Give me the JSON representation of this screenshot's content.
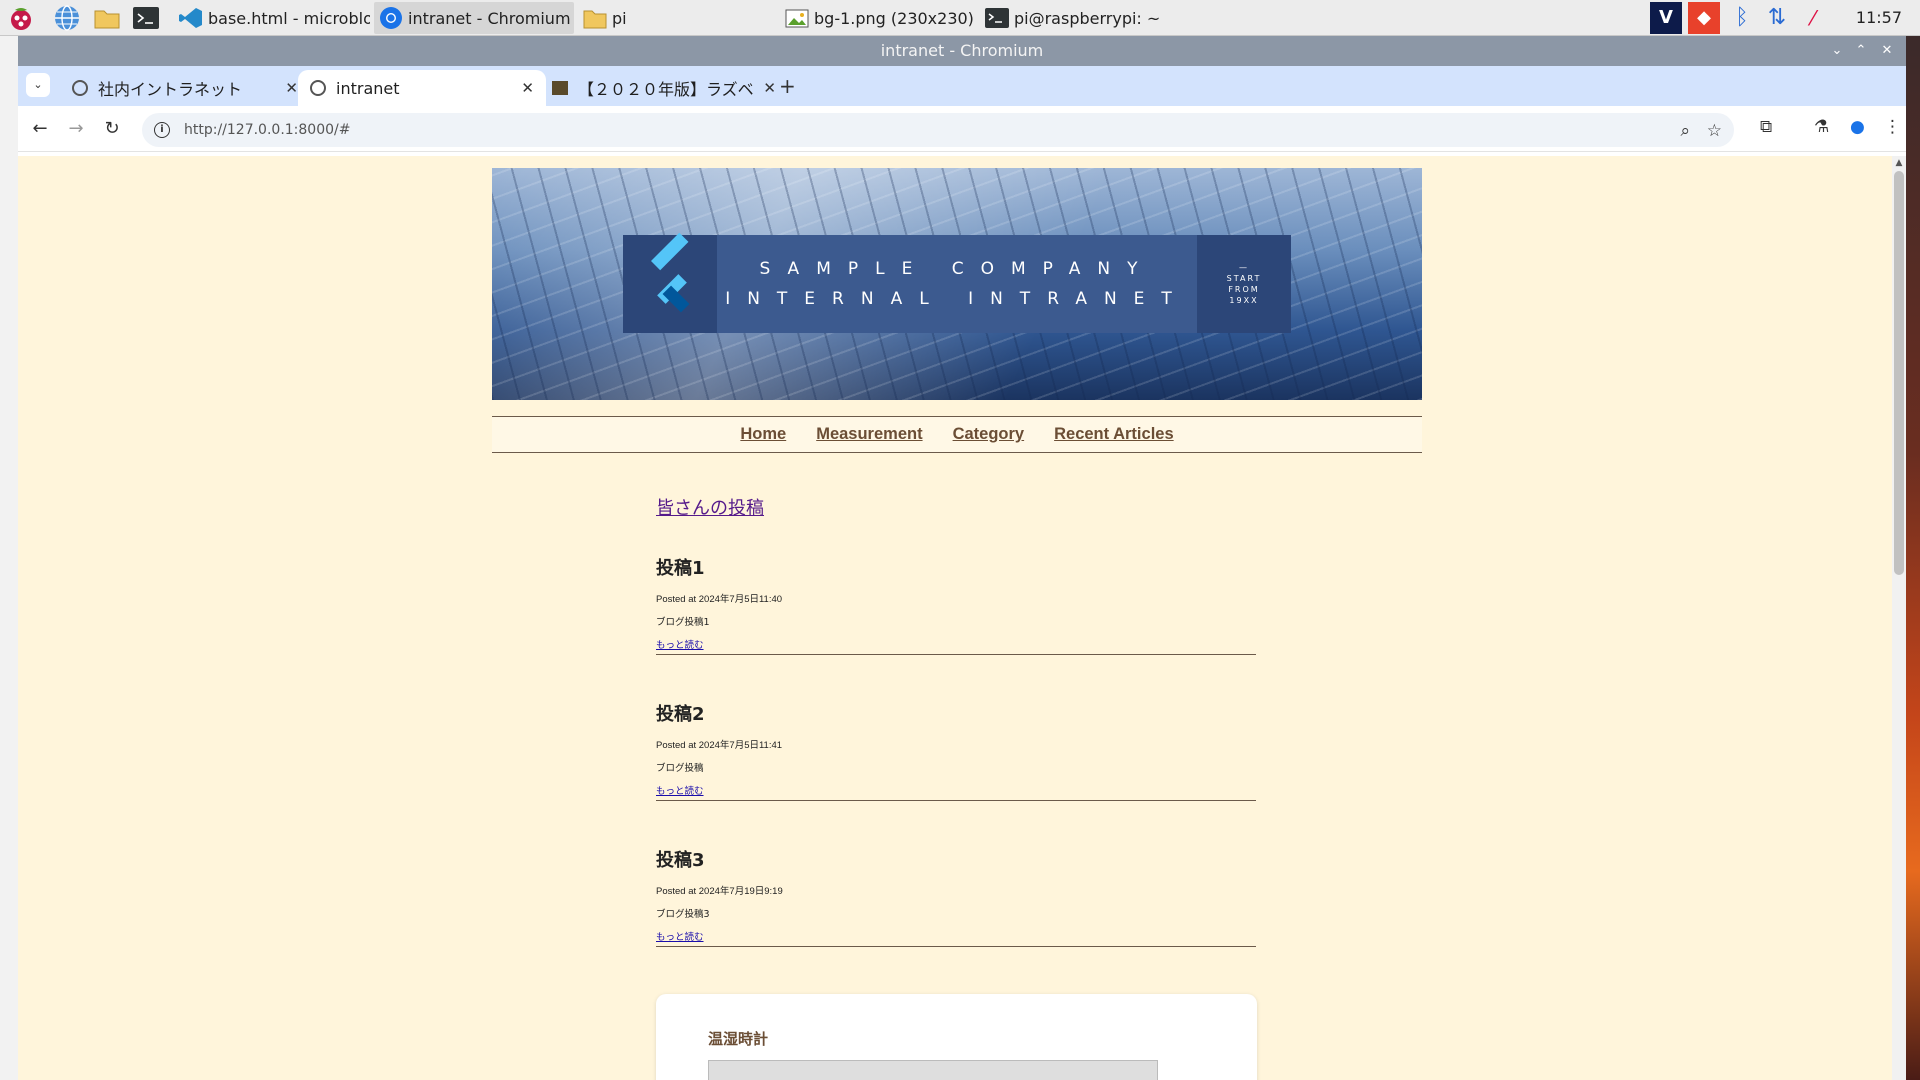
{
  "taskbar": {
    "tasks": [
      {
        "label": "base.html - microblo..."
      },
      {
        "label": "intranet - Chromium"
      },
      {
        "label": "pi"
      },
      {
        "label": "bg-1.png (230x230) ..."
      },
      {
        "label": "pi@raspberrypi: ~"
      }
    ],
    "clock": "11:57"
  },
  "browser": {
    "window_title": "intranet - Chromium",
    "tabs": [
      {
        "label": "社内イントラネット"
      },
      {
        "label": "intranet"
      },
      {
        "label": "【２０２０年版】ラズベ"
      }
    ],
    "url": "http://127.0.0.1:8000/#"
  },
  "page": {
    "banner": {
      "line1": "SAMPLE COMPANY",
      "line2": "INTERNAL INTRANET",
      "side1": "—",
      "side2": "START",
      "side3": "FROM",
      "side4": "19XX"
    },
    "nav": [
      "Home",
      "Measurement",
      "Category",
      "Recent Articles"
    ],
    "section_title": "皆さんの投稿",
    "posts": [
      {
        "title": "投稿1",
        "meta": "Posted at 2024年7月5日11:40",
        "body": "ブログ投稿1",
        "more": "もっと読む"
      },
      {
        "title": "投稿2",
        "meta": "Posted at 2024年7月5日11:41",
        "body": "ブログ投稿",
        "more": "もっと読む"
      },
      {
        "title": "投稿3",
        "meta": "Posted at 2024年7月19日9:19",
        "body": "ブログ投稿3",
        "more": "もっと読む"
      }
    ],
    "widget_title": "温湿時計"
  },
  "colors": {
    "page_bg": "#fff5db",
    "nav_text": "#6b4e35",
    "link_visited": "#551a8b",
    "link": "#1a0dab",
    "titlebar": "#8c97a6",
    "tabstrip": "#d3e3fd"
  }
}
